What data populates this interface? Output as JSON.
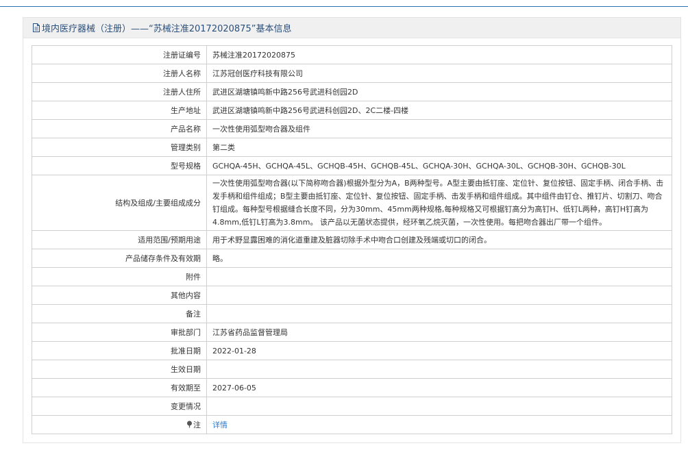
{
  "panel": {
    "title": "境内医疗器械（注册）——“苏械注准20172020875”基本信息"
  },
  "rows": [
    {
      "label": "注册证编号",
      "value": "苏械注准20172020875"
    },
    {
      "label": "注册人名称",
      "value": "江苏冠创医疗科技有限公司"
    },
    {
      "label": "注册人住所",
      "value": "武进区湖塘镇鸣新中路256号武进科创园2D"
    },
    {
      "label": "生产地址",
      "value": "武进区湖塘镇鸣新中路256号武进科创园2D、2C二楼-四楼"
    },
    {
      "label": "产品名称",
      "value": "一次性使用弧型吻合器及组件"
    },
    {
      "label": "管理类别",
      "value": "第二类"
    },
    {
      "label": "型号规格",
      "value": "GCHQA-45H、GCHQA-45L、GCHQB-45H、GCHQB-45L、GCHQA-30H、GCHQA-30L、GCHQB-30H、GCHQB-30L"
    },
    {
      "label": "结构及组成/主要组成成分",
      "value": "一次性使用弧型吻合器(以下简称吻合器)根据外型分为A，B两种型号。A型主要由抵钉座、定位针、复位按钮、固定手柄、闭合手柄、击发手柄和组件组成；B型主要由抵钉座、定位针、复位按钮、固定手柄、击发手柄和组件组成。其中组件由钉仓、推钉片、切割刀、吻合钉组成。每种型号根据缝合长度不同，分为30mm、45mm两种规格,每种规格又可根据钉高分为高钉H、低钉L两种，高钉H钉高为4.8mm,低钉L钉高为3.8mm。 该产品以无菌状态提供，经环氧乙烷灭菌，一次性使用。每把吻合器出厂带一个组件。"
    },
    {
      "label": "适用范围/预期用途",
      "value": "用于术野显露困难的消化道重建及脏器切除手术中吻合口创建及残端或切口的闭合。"
    },
    {
      "label": "产品储存条件及有效期",
      "value": "略。"
    },
    {
      "label": "附件",
      "value": ""
    },
    {
      "label": "其他内容",
      "value": ""
    },
    {
      "label": "备注",
      "value": ""
    },
    {
      "label": "审批部门",
      "value": "江苏省药品监督管理局"
    },
    {
      "label": "批准日期",
      "value": "2022-01-28"
    },
    {
      "label": "生效日期",
      "value": ""
    },
    {
      "label": "有效期至",
      "value": "2027-06-05"
    },
    {
      "label": "变更情况",
      "value": ""
    },
    {
      "label": "注",
      "value": "详情"
    }
  ],
  "icons": {
    "title_icon": "document-icon",
    "note_icon": "pin-icon"
  },
  "colors": {
    "accent_line": "#2b6eb5",
    "title_text": "#2b4f7b",
    "link": "#2b7bd0"
  }
}
